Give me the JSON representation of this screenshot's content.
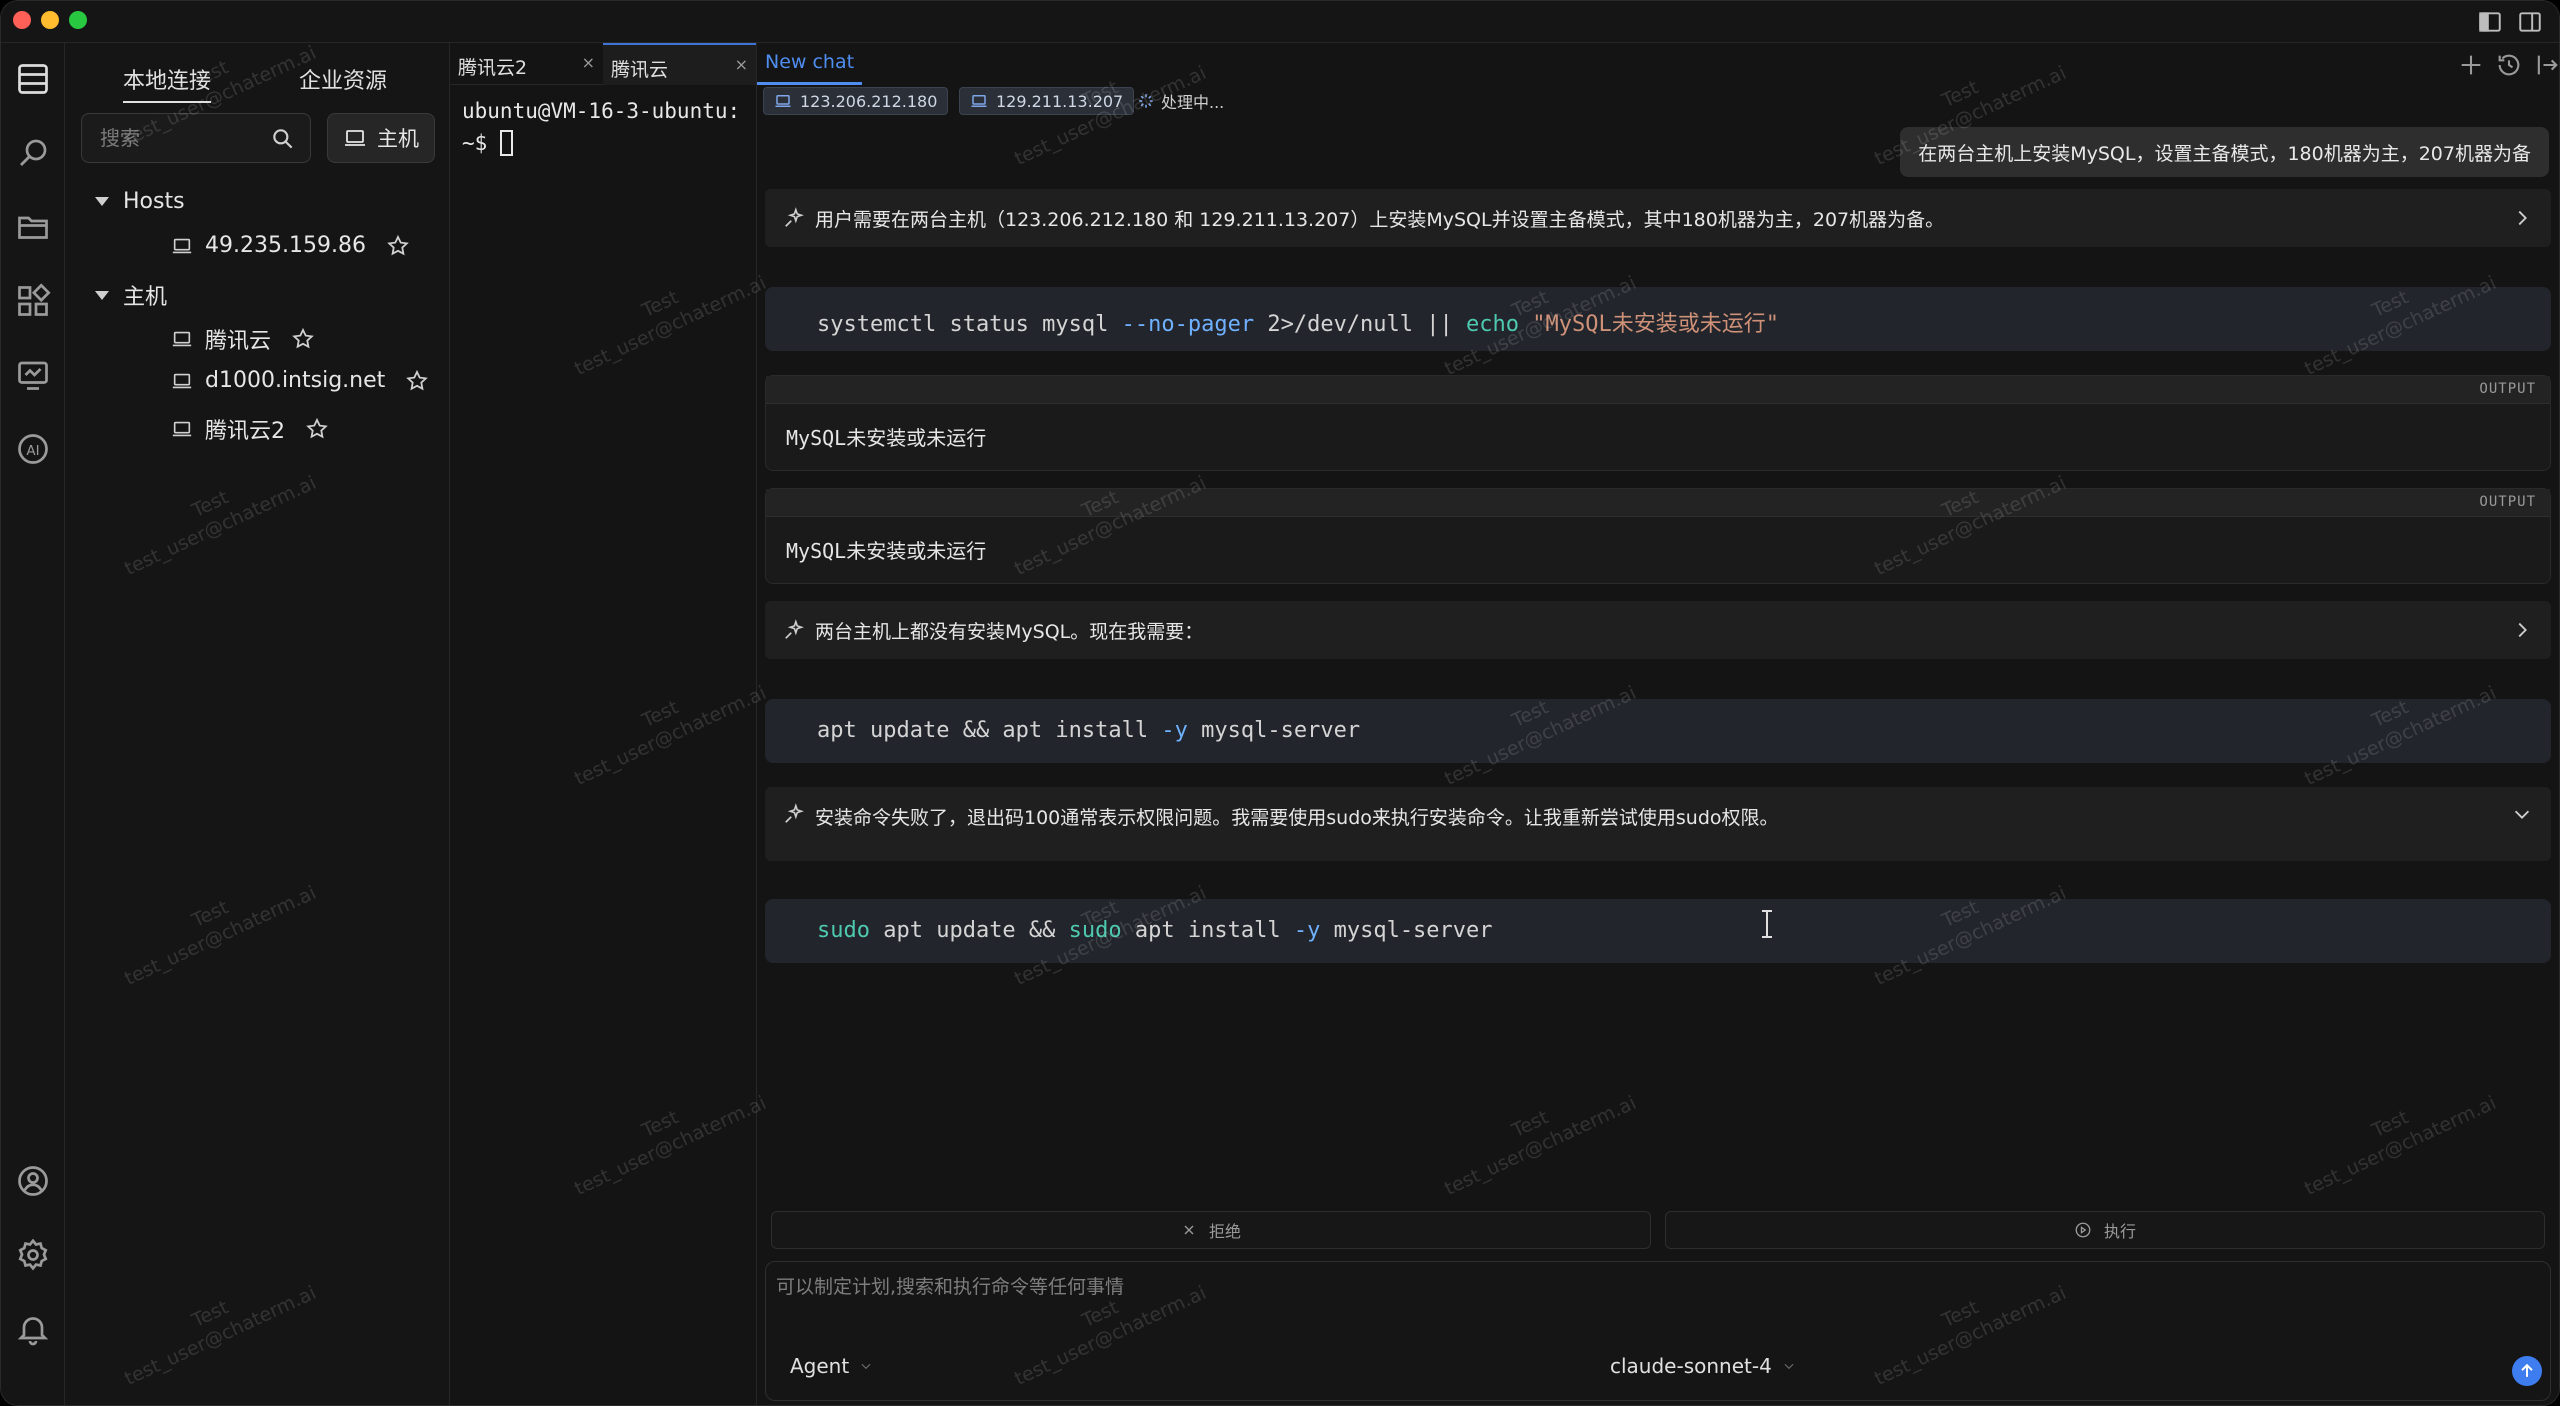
{
  "sidebar": {
    "tab_local": "本地连接",
    "tab_enterprise": "企业资源",
    "search_placeholder": "搜索",
    "host_button_label": "主机",
    "groups": [
      {
        "label": "Hosts",
        "items": [
          "49.235.159.86"
        ]
      },
      {
        "label": "主机",
        "items": [
          "腾讯云",
          "d1000.intsig.net",
          "腾讯云2"
        ]
      }
    ]
  },
  "terminal": {
    "tabs": [
      {
        "label": "腾讯云2",
        "close": "×"
      },
      {
        "label": "腾讯云",
        "close": "×"
      }
    ],
    "prompt": "ubuntu@VM-16-3-ubuntu:~$ "
  },
  "chat": {
    "tab_label": "New chat",
    "hosts": [
      "123.206.212.180",
      "129.211.13.207"
    ],
    "status": "处理中...",
    "user_message": "在两台主机上安装MySQL，设置主备模式，180机器为主，207机器为备",
    "thought1": "用户需要在两台主机（123.206.212.180 和 129.211.13.207）上安装MySQL并设置主备模式，其中180机器为主，207机器为备。",
    "cmd1": {
      "a": "systemctl status mysql ",
      "b": "--no-pager",
      "c": " 2>/dev/null || ",
      "d": "echo",
      "e": " ",
      "f": "\"MySQL未安装或未运行\""
    },
    "output_label": "OUTPUT",
    "output1": "MySQL未安装或未运行",
    "output2": "MySQL未安装或未运行",
    "thought2": "两台主机上都没有安装MySQL。现在我需要：",
    "cmd2": {
      "a": "apt update && apt install ",
      "b": "-y",
      "c": " mysql-server"
    },
    "thought3": "安装命令失败了，退出码100通常表示权限问题。我需要使用sudo来执行安装命令。让我重新尝试使用sudo权限。",
    "cmd3": {
      "a": "sudo",
      "b": " apt update && ",
      "c": "sudo",
      "d": " apt install ",
      "e": "-y",
      "f": " mysql-server"
    },
    "reject_label": "拒绝",
    "execute_label": "执行",
    "input_placeholder": "可以制定计划,搜索和执行命令等任何事情",
    "mode": "Agent",
    "model": "claude-sonnet-4"
  },
  "watermark": {
    "line1": "Test",
    "line2": "test_user@chaterm.ai"
  }
}
